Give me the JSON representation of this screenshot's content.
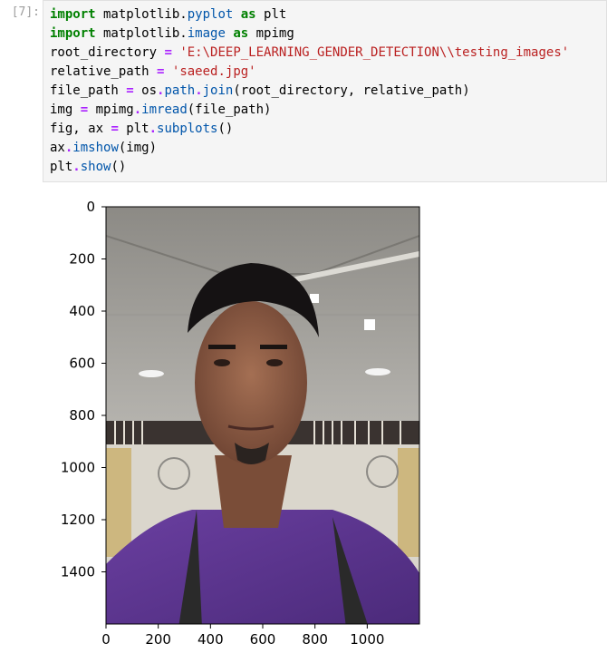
{
  "cell": {
    "prompt": "[7]:",
    "code_lines": [
      {
        "parts": [
          {
            "t": "import",
            "c": "kw"
          },
          {
            "t": " matplotlib",
            "c": ""
          },
          {
            "t": ".",
            "c": ""
          },
          {
            "t": "pyplot",
            "c": "attr"
          },
          {
            "t": " ",
            "c": ""
          },
          {
            "t": "as",
            "c": "kw"
          },
          {
            "t": " plt",
            "c": ""
          }
        ]
      },
      {
        "parts": [
          {
            "t": "import",
            "c": "kw"
          },
          {
            "t": " matplotlib",
            "c": ""
          },
          {
            "t": ".",
            "c": ""
          },
          {
            "t": "image",
            "c": "attr"
          },
          {
            "t": " ",
            "c": ""
          },
          {
            "t": "as",
            "c": "kw"
          },
          {
            "t": " mpimg",
            "c": ""
          }
        ]
      },
      {
        "parts": [
          {
            "t": "root_directory ",
            "c": ""
          },
          {
            "t": "=",
            "c": "op"
          },
          {
            "t": " ",
            "c": ""
          },
          {
            "t": "'E:\\DEEP_LEARNING_GENDER_DETECTION\\\\testing_images'",
            "c": "str"
          }
        ]
      },
      {
        "parts": [
          {
            "t": "relative_path ",
            "c": ""
          },
          {
            "t": "=",
            "c": "op"
          },
          {
            "t": " ",
            "c": ""
          },
          {
            "t": "'saeed.jpg'",
            "c": "str"
          }
        ]
      },
      {
        "parts": [
          {
            "t": "file_path ",
            "c": ""
          },
          {
            "t": "=",
            "c": "op"
          },
          {
            "t": " os",
            "c": ""
          },
          {
            "t": ".",
            "c": "op"
          },
          {
            "t": "path",
            "c": "attr"
          },
          {
            "t": ".",
            "c": "op"
          },
          {
            "t": "join",
            "c": "attr"
          },
          {
            "t": "(root_directory, relative_path)",
            "c": ""
          }
        ]
      },
      {
        "parts": [
          {
            "t": "img ",
            "c": ""
          },
          {
            "t": "=",
            "c": "op"
          },
          {
            "t": " mpimg",
            "c": ""
          },
          {
            "t": ".",
            "c": "op"
          },
          {
            "t": "imread",
            "c": "attr"
          },
          {
            "t": "(file_path)",
            "c": ""
          }
        ]
      },
      {
        "parts": [
          {
            "t": "fig, ax ",
            "c": ""
          },
          {
            "t": "=",
            "c": "op"
          },
          {
            "t": " plt",
            "c": ""
          },
          {
            "t": ".",
            "c": "op"
          },
          {
            "t": "subplots",
            "c": "attr"
          },
          {
            "t": "()",
            "c": ""
          }
        ]
      },
      {
        "parts": [
          {
            "t": "ax",
            "c": ""
          },
          {
            "t": ".",
            "c": "op"
          },
          {
            "t": "imshow",
            "c": "attr"
          },
          {
            "t": "(img)",
            "c": ""
          }
        ]
      },
      {
        "parts": [
          {
            "t": "plt",
            "c": ""
          },
          {
            "t": ".",
            "c": "op"
          },
          {
            "t": "show",
            "c": "attr"
          },
          {
            "t": "()",
            "c": ""
          }
        ]
      }
    ]
  },
  "chart_data": {
    "type": "image",
    "x_ticks": [
      0,
      200,
      400,
      600,
      800,
      1000
    ],
    "y_ticks": [
      0,
      200,
      400,
      600,
      800,
      1000,
      1200,
      1400
    ],
    "xlim": [
      0,
      1200
    ],
    "ylim": [
      1600,
      0
    ]
  }
}
